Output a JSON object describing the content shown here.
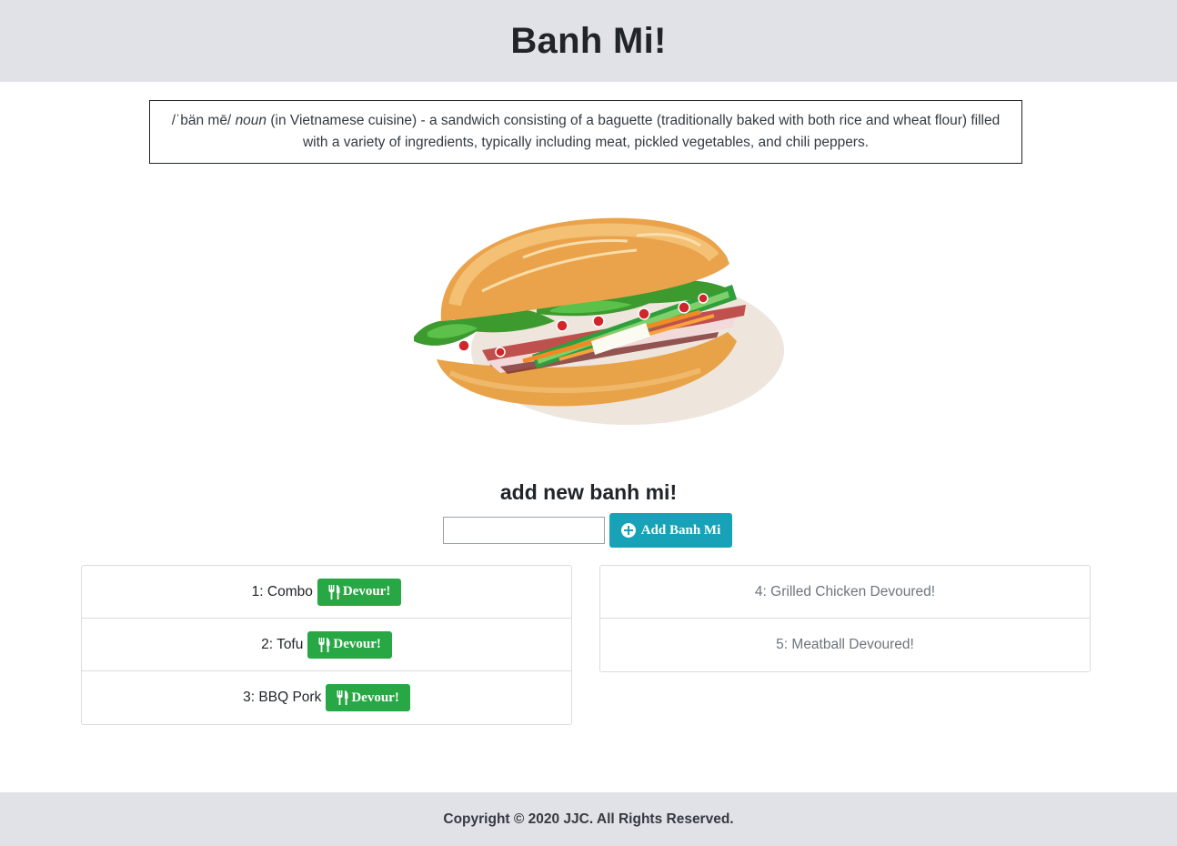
{
  "header": {
    "title": "Banh Mi!"
  },
  "definition": {
    "pronunciation": "/ˈbän mē/",
    "part_of_speech": "noun",
    "text": "(in Vietnamese cuisine) - a sandwich consisting of a baguette (traditionally baked with both rice and wheat flour) filled with a variety of ingredients, typically including meat, pickled vegetables, and chili peppers."
  },
  "add_form": {
    "title": "add new banh mi!",
    "input_value": "",
    "button_label": "Add Banh Mi",
    "button_icon": "plus-circle-icon"
  },
  "to_devour": {
    "button_label": "Devour!",
    "button_icon": "utensils-icon",
    "items": [
      {
        "label": "1: Combo"
      },
      {
        "label": "2: Tofu"
      },
      {
        "label": "3: BBQ Pork"
      }
    ]
  },
  "devoured": {
    "items": [
      {
        "label": "4: Grilled Chicken Devoured!"
      },
      {
        "label": "5: Meatball Devoured!"
      }
    ]
  },
  "footer": {
    "text": "Copyright © 2020 JJC. All Rights Reserved."
  },
  "colors": {
    "header_bg": "#e1e2e7",
    "add_button": "#17a2b8",
    "devour_button": "#28a745",
    "devoured_text": "#6c757d"
  }
}
